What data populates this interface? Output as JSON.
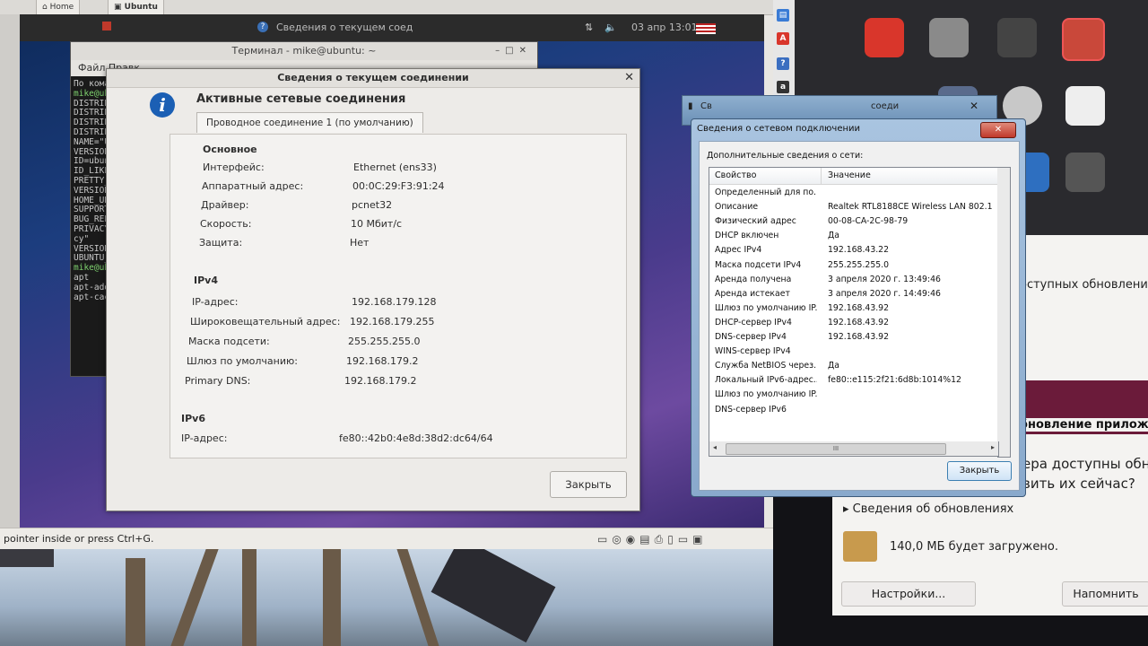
{
  "host_tabs": {
    "home": "Home",
    "ubuntu": "Ubuntu"
  },
  "ubuntu_topbar": {
    "window_title": "Сведения о текущем соед",
    "clock": "03 апр 13:01"
  },
  "terminal": {
    "title": "Терминал - mike@ubuntu: ~",
    "menu": "Файл  Правк",
    "lines": [
      "По команде '",
      "mike@ubuntu",
      "DISTRIB_ID=U",
      "DISTRIB_RELE",
      "DISTRIB_CODEN",
      "DISTRIB_DESCR",
      "NAME=\"Ubuntu\"",
      "VERSION=\"18.",
      "ID=ubuntu",
      "ID_LIKE=debia",
      "PRETTY_NAME=",
      "VERSION_ID=\"",
      "HOME_URL=\"htt",
      "SUPPORT_URL=",
      "BUG_REPORT_U",
      "PRIVACY_POLIC",
      "cy\"",
      "VERSION_CODEN",
      "UBUNTU_CODENA",
      "mike@ubuntu:",
      "apt",
      "apt-add-repos",
      "apt-cache"
    ]
  },
  "gtk_dialog": {
    "title": "Сведения о текущем соединении",
    "heading": "Активные сетевые соединения",
    "tab": "Проводное соединение 1 (по умолчанию)",
    "section_basic": "Основное",
    "basic": [
      {
        "key": "Интерфейс:",
        "value": "Ethernet (ens33)"
      },
      {
        "key": "Аппаратный адрес:",
        "value": "00:0C:29:F3:91:24"
      },
      {
        "key": "Драйвер:",
        "value": "pcnet32"
      },
      {
        "key": "Скорость:",
        "value": "10 Мбит/с"
      },
      {
        "key": "Защита:",
        "value": "Нет"
      }
    ],
    "section_ipv4": "IPv4",
    "ipv4": [
      {
        "key": "IP-адрес:",
        "value": "192.168.179.128"
      },
      {
        "key": "Широковещательный адрес:",
        "value": "192.168.179.255"
      },
      {
        "key": "Маска подсети:",
        "value": "255.255.255.0"
      },
      {
        "key": "Шлюз по умолчанию:",
        "value": "192.168.179.2"
      },
      {
        "key": "Primary DNS:",
        "value": "192.168.179.2"
      }
    ],
    "section_ipv6": "IPv6",
    "ipv6": [
      {
        "key": "IP-адрес:",
        "value": "fe80::42b0:4e8d:38d2:dc64/64"
      }
    ],
    "close_label": "Закрыть"
  },
  "vm_status": {
    "text": "pointer inside or press Ctrl+G."
  },
  "win_dialog": {
    "back_title": "Св",
    "back_title_right": "соеди",
    "title": "Сведения о сетевом подключении",
    "caption": "Дополнительные сведения о сети:",
    "col_property": "Свойство",
    "col_value": "Значение",
    "rows": [
      {
        "key": "Определенный для по...",
        "value": ""
      },
      {
        "key": "Описание",
        "value": "Realtek RTL8188CE Wireless LAN 802.1"
      },
      {
        "key": "Физический адрес",
        "value": "00-08-CA-2C-98-79"
      },
      {
        "key": "DHCP включен",
        "value": "Да"
      },
      {
        "key": "Адрес IPv4",
        "value": "192.168.43.22"
      },
      {
        "key": "Маска подсети IPv4",
        "value": "255.255.255.0"
      },
      {
        "key": "Аренда получена",
        "value": "3 апреля 2020 г. 13:49:46"
      },
      {
        "key": "Аренда истекает",
        "value": "3 апреля 2020 г. 14:49:46"
      },
      {
        "key": "Шлюз по умолчанию IP...",
        "value": "192.168.43.92"
      },
      {
        "key": "DHCP-сервер IPv4",
        "value": "192.168.43.92"
      },
      {
        "key": "DNS-сервер IPv4",
        "value": "192.168.43.92"
      },
      {
        "key": "WINS-сервер IPv4",
        "value": ""
      },
      {
        "key": "Служба NetBIOS через...",
        "value": "Да"
      },
      {
        "key": "Локальный IPv6-адрес...",
        "value": "fe80::e115:2f21:6d8b:1014%12"
      },
      {
        "key": "Шлюз по умолчанию IP...",
        "value": ""
      },
      {
        "key": "DNS-сервер IPv6",
        "value": ""
      }
    ],
    "scroll_grip": "III",
    "close_label": "Закрыть"
  },
  "ubuntu_update": {
    "line1": "доступных обновлений",
    "line2": "обновление приложени",
    "line3": "ера доступны обно",
    "line4": "вить их сейчас?",
    "details": "Сведения об обновлениях",
    "download": "140,0 МБ будет загружено.",
    "settings_btn": "Настройки...",
    "remind_btn": "Напомнить"
  },
  "launcher_icons": [
    "document-icon",
    "app-a-icon",
    "help-icon",
    "amazon-icon"
  ]
}
